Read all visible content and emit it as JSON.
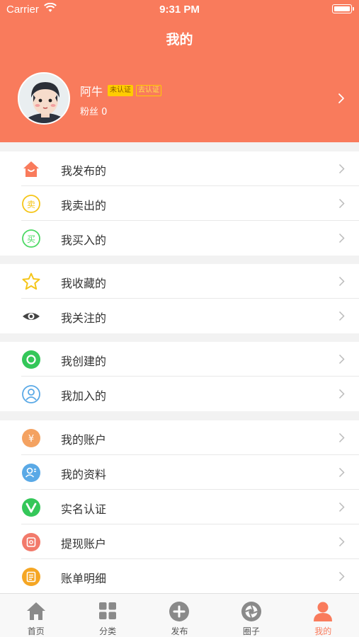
{
  "status": {
    "carrier": "Carrier",
    "time": "9:31 PM"
  },
  "nav": {
    "title": "我的"
  },
  "profile": {
    "name": "阿牛",
    "badge_unverified": "未认证",
    "badge_verified": "去认证",
    "followers": "粉丝 0"
  },
  "menu": {
    "group1": [
      {
        "label": "我发布的",
        "icon": "house-icon"
      },
      {
        "label": "我卖出的",
        "icon": "sell-icon"
      },
      {
        "label": "我买入的",
        "icon": "buy-icon"
      }
    ],
    "group2": [
      {
        "label": "我收藏的",
        "icon": "star-icon"
      },
      {
        "label": "我关注的",
        "icon": "eye-icon"
      }
    ],
    "group3": [
      {
        "label": "我创建的",
        "icon": "create-icon"
      },
      {
        "label": "我加入的",
        "icon": "join-icon"
      }
    ],
    "group4": [
      {
        "label": "我的账户",
        "icon": "yuan-icon"
      },
      {
        "label": "我的资料",
        "icon": "profile-icon"
      },
      {
        "label": "实名认证",
        "icon": "verify-icon"
      },
      {
        "label": "提现账户",
        "icon": "withdraw-icon"
      },
      {
        "label": "账单明细",
        "icon": "bill-icon"
      }
    ]
  },
  "tabs": [
    {
      "label": "首页",
      "icon": "home-icon"
    },
    {
      "label": "分类",
      "icon": "grid-icon"
    },
    {
      "label": "发布",
      "icon": "plus-icon"
    },
    {
      "label": "圈子",
      "icon": "aperture-icon"
    },
    {
      "label": "我的",
      "icon": "person-icon",
      "active": true
    }
  ],
  "colors": {
    "accent": "#f97b5c",
    "yellow": "#ffcc00",
    "green": "#4cd964",
    "blue": "#5aa9e6"
  }
}
